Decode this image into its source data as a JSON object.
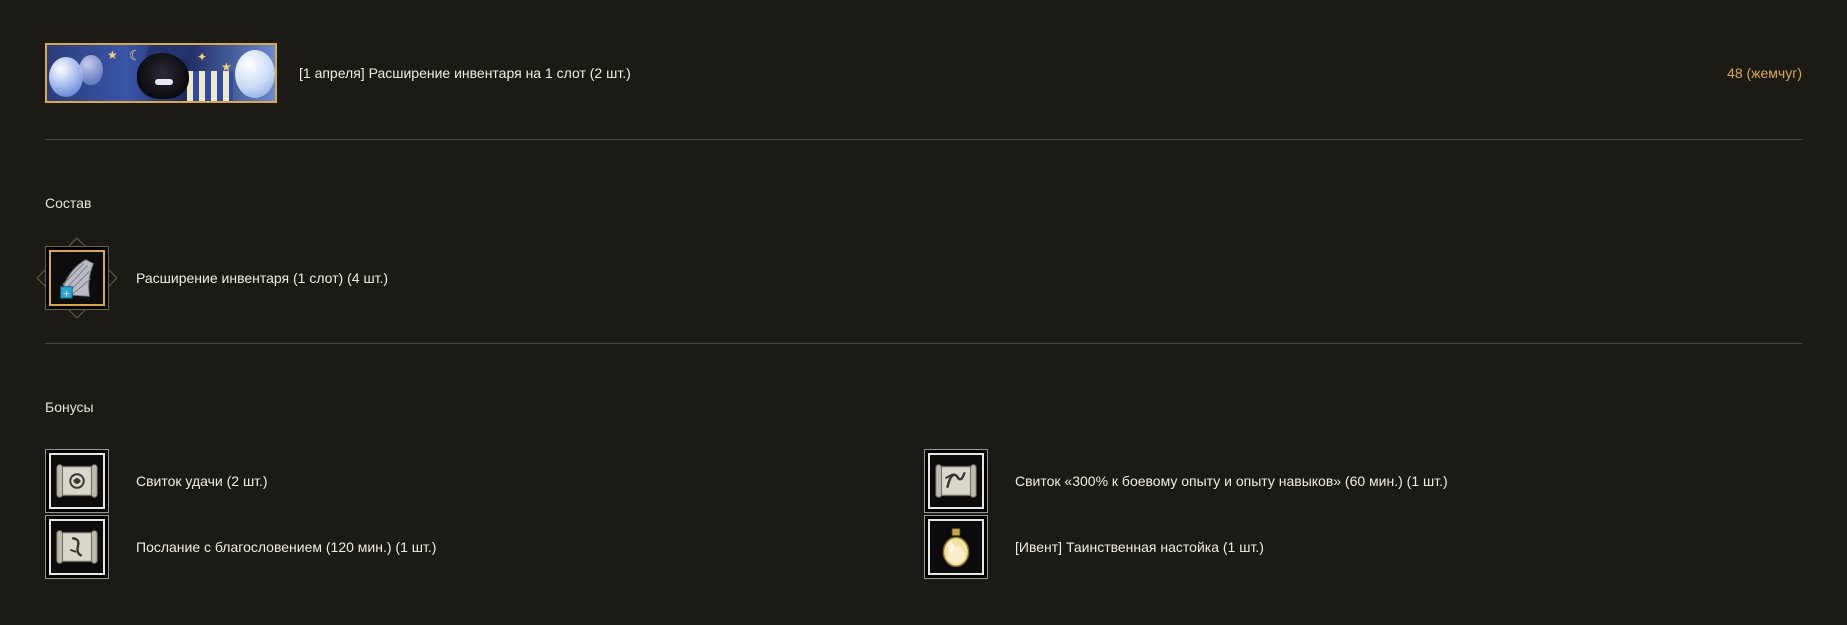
{
  "product": {
    "title": "[1 апреля] Расширение инвентаря на 1 слот (2 шт.)",
    "price": "48 (жемчуг)",
    "banner_icon": "event-banner-image"
  },
  "composition": {
    "heading": "Состав",
    "items": [
      {
        "label": "Расширение инвентаря (1 слот) (4 шт.)",
        "icon": "inventory-bag-icon"
      }
    ]
  },
  "bonuses": {
    "heading": "Бонусы",
    "items": [
      {
        "label": "Свиток удачи (2 шт.)",
        "icon": "scroll-icon"
      },
      {
        "label": "Свиток «300% к боевому опыту и опыту навыков» (60 мин.) (1 шт.)",
        "icon": "scroll-icon"
      },
      {
        "label": "Послание с благословением (120 мин.) (1 шт.)",
        "icon": "scroll-icon"
      },
      {
        "label": "[Ивент] Таинственная настойка (1 шт.)",
        "icon": "potion-icon"
      }
    ]
  },
  "colors": {
    "background": "#1b1a14",
    "accent": "#d9a84a",
    "text": "#f1ede2",
    "divider": "#4a473c"
  }
}
